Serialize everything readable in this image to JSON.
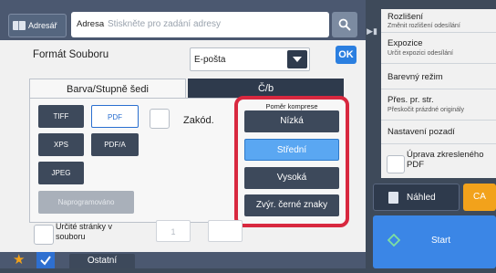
{
  "topbar": {
    "addressbook_label": "Adresář",
    "address_label": "Adresa",
    "address_placeholder": "Stiskněte pro zadání adresy"
  },
  "format": {
    "label": "Formát Souboru",
    "selected": "E-pošta",
    "ok": "OK"
  },
  "tabs": [
    {
      "label": "Barva/Stupně šedi",
      "active": true
    },
    {
      "label": "Č/b",
      "active": false
    }
  ],
  "file_types": [
    "TIFF",
    "PDF",
    "XPS",
    "PDF/A",
    "JPEG"
  ],
  "selected_file_type": "PDF",
  "programmed_label": "Naprogramováno",
  "encrypt_label": "Zakód.",
  "compression": {
    "title": "Poměr komprese",
    "options": [
      "Nízká",
      "Střední",
      "Vysoká",
      "Zvýr. černé znaky"
    ],
    "selected": "Střední"
  },
  "specific_pages": {
    "label_line1": "Určité stránky v",
    "label_line2": "souboru",
    "value": "1"
  },
  "bottom": {
    "others_label": "Ostatní"
  },
  "right_menu": [
    {
      "title": "Rozlišení",
      "sub": "Změnit rozlišení odesílání"
    },
    {
      "title": "Expozice",
      "sub": "Určit expozici odesílání"
    },
    {
      "title": "Barevný režim",
      "sub": ""
    },
    {
      "title": "Přes. pr. str.",
      "sub": "Přeskočit prázdné originály"
    },
    {
      "title": "Nastavení pozadí",
      "sub": ""
    }
  ],
  "drawing_fix": {
    "line1": "Úprava zkresleného",
    "line2": "PDF"
  },
  "actions": {
    "preview_label": "Náhled",
    "ca_label": "CA",
    "start_label": "Start"
  },
  "colors": {
    "accent": "#3b86e6",
    "highlight": "#d8283f",
    "ca": "#f2a21b"
  }
}
